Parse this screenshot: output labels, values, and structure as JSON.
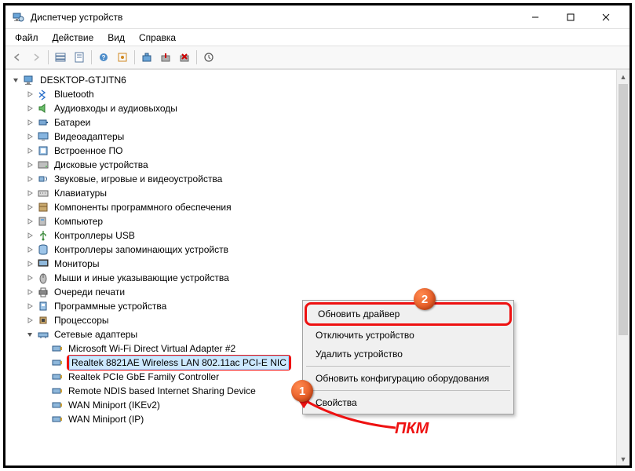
{
  "window": {
    "title": "Диспетчер устройств",
    "controls": {
      "min": "–",
      "max": "☐",
      "close": "✕"
    }
  },
  "menubar": [
    "Файл",
    "Действие",
    "Вид",
    "Справка"
  ],
  "tree": {
    "root": "DESKTOP-GTJITN6",
    "categories": [
      "Bluetooth",
      "Аудиовходы и аудиовыходы",
      "Батареи",
      "Видеоадаптеры",
      "Встроенное ПО",
      "Дисковые устройства",
      "Звуковые, игровые и видеоустройства",
      "Клавиатуры",
      "Компоненты программного обеспечения",
      "Компьютер",
      "Контроллеры USB",
      "Контроллеры запоминающих устройств",
      "Мониторы",
      "Мыши и иные указывающие устройства",
      "Очереди печати",
      "Программные устройства",
      "Процессоры",
      "Сетевые адаптеры"
    ],
    "network_adapters": [
      "Microsoft Wi-Fi Direct Virtual Adapter #2",
      "Realtek 8821AE Wireless LAN 802.11ac PCI-E NIC",
      "Realtek PCIe GbE Family Controller",
      "Remote NDIS based Internet Sharing Device",
      "WAN Miniport (IKEv2)",
      "WAN Miniport (IP)"
    ],
    "selected_index": 1
  },
  "context_menu": {
    "items": [
      "Обновить драйвер",
      "Отключить устройство",
      "Удалить устройство",
      "Обновить конфигурацию оборудования",
      "Свойства"
    ],
    "highlighted_index": 0
  },
  "annotations": {
    "badge1": "1",
    "badge2": "2",
    "pkm": "ПКМ"
  }
}
